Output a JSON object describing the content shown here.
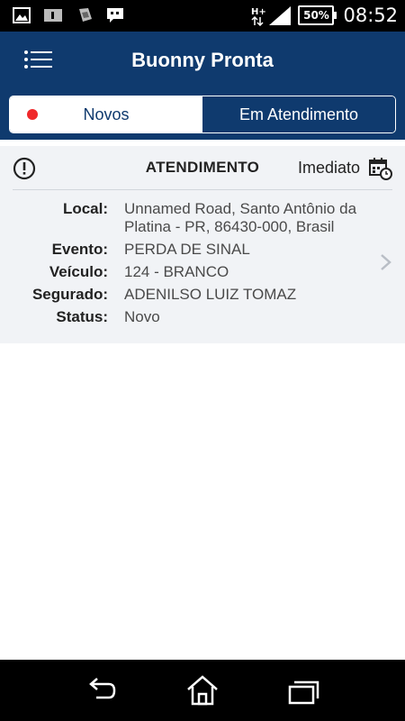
{
  "status_bar": {
    "network": "H+",
    "battery": "50%",
    "time": "08:52"
  },
  "app_bar": {
    "title": "Buonny Pronta"
  },
  "tabs": [
    {
      "label": "Novos",
      "active": true
    },
    {
      "label": "Em Atendimento",
      "active": false
    }
  ],
  "card": {
    "title": "ATENDIMENTO",
    "priority": "Imediato",
    "fields": [
      {
        "label": "Local:",
        "value": "Unnamed Road, Santo Antônio da Platina - PR, 86430-000, Brasil"
      },
      {
        "label": "Evento:",
        "value": "PERDA DE SINAL"
      },
      {
        "label": "Veículo:",
        "value": "124 - BRANCO"
      },
      {
        "label": "Segurado:",
        "value": "ADENILSO LUIZ TOMAZ"
      },
      {
        "label": "Status:",
        "value": "Novo"
      }
    ]
  },
  "colors": {
    "primary": "#0f3a6e",
    "new_indicator": "#f0282a",
    "card_bg": "#f1f3f6"
  },
  "icons": [
    "image-icon",
    "info-card-icon",
    "sim-icon",
    "message-icon",
    "signal-icon",
    "menu-icon",
    "alert-icon",
    "calendar-clock-icon",
    "chevron-right-icon",
    "back-icon",
    "home-icon",
    "recents-icon"
  ]
}
